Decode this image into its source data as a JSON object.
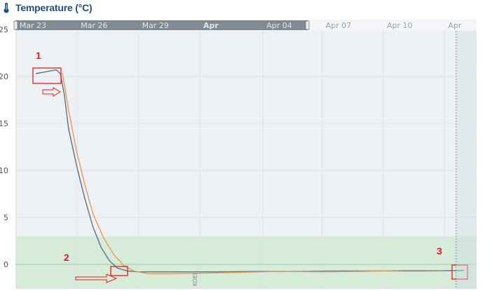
{
  "header": {
    "title": "Temperature (°C)",
    "icon": "thermometer-icon"
  },
  "chart_data": {
    "type": "line",
    "title": "Temperature (°C)",
    "xlabel": "",
    "ylabel": "",
    "ylim": [
      -2.5,
      25
    ],
    "y_ticks": [
      "25",
      "20",
      "15",
      "10",
      "5",
      "0"
    ],
    "x_ticks": [
      "Mar 23",
      "Mar 26",
      "Mar 29",
      "Apr",
      "Apr 04",
      "Apr 07",
      "Apr 10",
      "Apr"
    ],
    "x_range_days": [
      "Mar 22",
      "Apr 13"
    ],
    "navigator_selected_ticks": [
      "Mar 23",
      "Mar 26",
      "Mar 29",
      "Apr",
      "Apr 04"
    ],
    "band": {
      "from": -2.5,
      "to": 3,
      "color": "#d6ecd9"
    },
    "grid": true,
    "colors": {
      "series_blue": "#5a7287",
      "series_orange": "#e69a5c",
      "band": "#d6ecd9",
      "annotation": "#e02020",
      "title": "#1f4f82"
    },
    "series": [
      {
        "color": "#5a7287",
        "points": [
          [
            23.0,
            20.3
          ],
          [
            23.5,
            20.5
          ],
          [
            24.0,
            20.7
          ],
          [
            24.2,
            20.3
          ],
          [
            24.4,
            18.0
          ],
          [
            24.6,
            14.5
          ],
          [
            25.0,
            10.5
          ],
          [
            25.4,
            7.0
          ],
          [
            25.8,
            4.0
          ],
          [
            26.2,
            1.8
          ],
          [
            26.6,
            0.4
          ],
          [
            27.0,
            -0.4
          ],
          [
            27.5,
            -0.7
          ],
          [
            28.0,
            -0.8
          ],
          [
            30.0,
            -0.8
          ],
          [
            32.0,
            -0.8
          ],
          [
            34.0,
            -0.75
          ],
          [
            36.0,
            -0.75
          ],
          [
            38.0,
            -0.7
          ],
          [
            40.0,
            -0.7
          ],
          [
            42.0,
            -0.7
          ],
          [
            44.0,
            -0.65
          ]
        ]
      },
      {
        "color": "#e69a5c",
        "points": [
          [
            24.3,
            20.4
          ],
          [
            24.6,
            16.5
          ],
          [
            25.0,
            12.0
          ],
          [
            25.4,
            8.5
          ],
          [
            25.8,
            5.4
          ],
          [
            26.3,
            2.9
          ],
          [
            26.8,
            1.1
          ],
          [
            27.3,
            -0.1
          ],
          [
            27.8,
            -0.7
          ],
          [
            28.5,
            -1.0
          ],
          [
            29.5,
            -1.0
          ],
          [
            31.0,
            -0.95
          ],
          [
            33.0,
            -0.85
          ],
          [
            35.0,
            -0.75
          ],
          [
            37.0,
            -0.8
          ],
          [
            39.0,
            -0.75
          ],
          [
            41.0,
            -0.65
          ],
          [
            43.0,
            -0.65
          ]
        ]
      }
    ],
    "annotations": [
      {
        "label": "1",
        "target": [
          24.0,
          20.5
        ]
      },
      {
        "label": "2",
        "target": [
          27.9,
          -0.7
        ]
      },
      {
        "label": "3",
        "target": [
          43.5,
          -0.7
        ]
      }
    ],
    "vertical_text": "KOEI"
  }
}
